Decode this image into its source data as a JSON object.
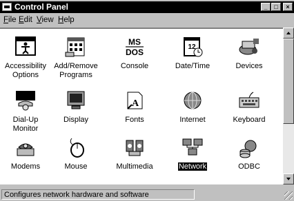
{
  "window": {
    "title": "Control Panel"
  },
  "title_buttons": {
    "minimize": "_",
    "maximize": "□",
    "close": "×"
  },
  "menu": [
    {
      "label": "File",
      "mnemonic": "F",
      "rest": "ile"
    },
    {
      "label": "Edit",
      "mnemonic": "E",
      "rest": "dit"
    },
    {
      "label": "View",
      "mnemonic": "V",
      "rest": "iew"
    },
    {
      "label": "Help",
      "mnemonic": "H",
      "rest": "elp"
    }
  ],
  "items": [
    {
      "label": "Accessibility Options",
      "icon": "accessibility-icon"
    },
    {
      "label": "Add/Remove Programs",
      "icon": "add-remove-programs-icon"
    },
    {
      "label": "Console",
      "icon": "console-icon"
    },
    {
      "label": "Date/Time",
      "icon": "date-time-icon"
    },
    {
      "label": "Devices",
      "icon": "devices-icon"
    },
    {
      "label": "Dial-Up Monitor",
      "icon": "dial-up-monitor-icon"
    },
    {
      "label": "Display",
      "icon": "display-icon"
    },
    {
      "label": "Fonts",
      "icon": "fonts-icon"
    },
    {
      "label": "Internet",
      "icon": "internet-icon"
    },
    {
      "label": "Keyboard",
      "icon": "keyboard-icon"
    },
    {
      "label": "Modems",
      "icon": "modems-icon"
    },
    {
      "label": "Mouse",
      "icon": "mouse-icon"
    },
    {
      "label": "Multimedia",
      "icon": "multimedia-icon"
    },
    {
      "label": "Network",
      "icon": "network-icon",
      "selected": true
    },
    {
      "label": "ODBC",
      "icon": "odbc-icon"
    }
  ],
  "status": {
    "text": "Configures network hardware and software"
  }
}
